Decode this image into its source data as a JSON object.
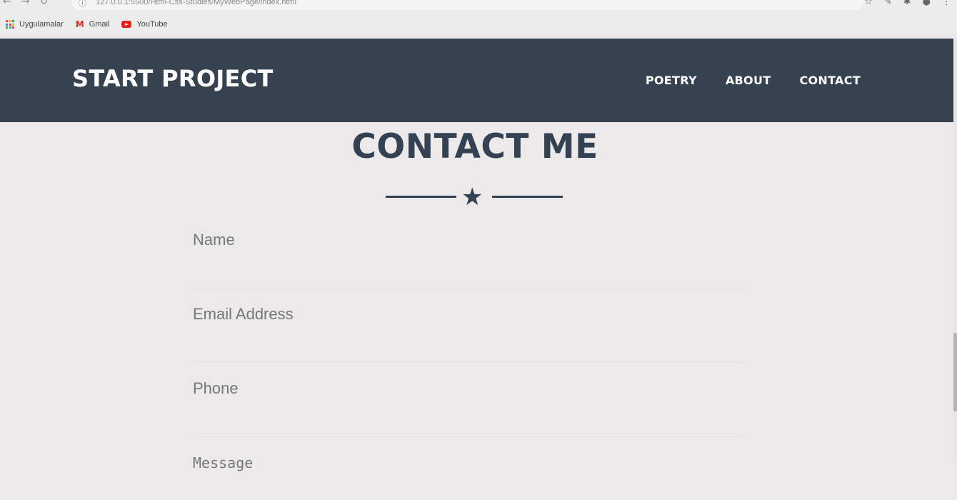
{
  "browser": {
    "url": "127.0.0.1:5500/Html-Css-Studies/MyWebPage/index.html",
    "bookmarks": [
      {
        "label": "Uygulamalar",
        "icon": "apps-grid-icon"
      },
      {
        "label": "Gmail",
        "icon": "gmail-icon"
      },
      {
        "label": "YouTube",
        "icon": "youtube-icon"
      }
    ]
  },
  "nav": {
    "brand": "START PROJECT",
    "links": [
      "POETRY",
      "ABOUT",
      "CONTACT"
    ],
    "background": "#364250"
  },
  "contact": {
    "title": "CONTACT ME",
    "divider_icon": "star-icon",
    "fields": {
      "name": {
        "placeholder": "Name",
        "value": ""
      },
      "email": {
        "placeholder": "Email Address",
        "value": ""
      },
      "phone": {
        "placeholder": "Phone",
        "value": ""
      },
      "message": {
        "placeholder": "Message",
        "value": ""
      }
    }
  },
  "colors": {
    "heading": "#344152",
    "page_bg": "#ebe9ea"
  }
}
